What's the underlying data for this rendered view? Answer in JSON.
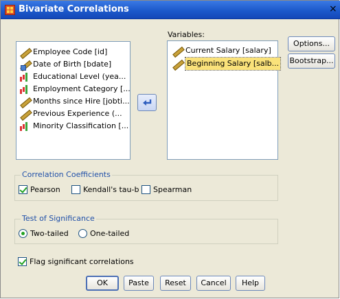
{
  "window": {
    "title": "Bivariate Correlations",
    "close": "×"
  },
  "source_list": {
    "items": [
      {
        "label": "Employee Code [id]",
        "icon": "ruler-icon"
      },
      {
        "label": "Date of Birth [bdate]",
        "icon": "date-ruler-icon"
      },
      {
        "label": "Educational Level (yea...",
        "icon": "bar-chart-icon"
      },
      {
        "label": "Employment Category [...",
        "icon": "bar-chart-icon"
      },
      {
        "label": "Months since Hire [jobti...",
        "icon": "ruler-icon"
      },
      {
        "label": "Previous Experience (...",
        "icon": "ruler-icon"
      },
      {
        "label": "Minority Classification [...",
        "icon": "bar-chart-icon"
      }
    ]
  },
  "variables": {
    "label": "Variables:",
    "items": [
      {
        "label": "Current Salary [salary]",
        "icon": "ruler-icon",
        "selected": false
      },
      {
        "label": "Beginning Salary [salb...",
        "icon": "ruler-icon",
        "selected": true
      }
    ]
  },
  "side_buttons": {
    "options": "Options...",
    "bootstrap": "Bootstrap..."
  },
  "correlation": {
    "legend": "Correlation Coefficients",
    "pearson": "Pearson",
    "pearson_checked": true,
    "kendall": "Kendall's tau-b",
    "kendall_checked": false,
    "spearman": "Spearman",
    "spearman_checked": false
  },
  "significance": {
    "legend": "Test of Significance",
    "two_tailed": "Two-tailed",
    "one_tailed": "One-tailed",
    "selected": "two_tailed"
  },
  "flag": {
    "label": "Flag significant correlations",
    "checked": true
  },
  "footer": {
    "ok": "OK",
    "paste": "Paste",
    "reset": "Reset",
    "cancel": "Cancel",
    "help": "Help"
  }
}
